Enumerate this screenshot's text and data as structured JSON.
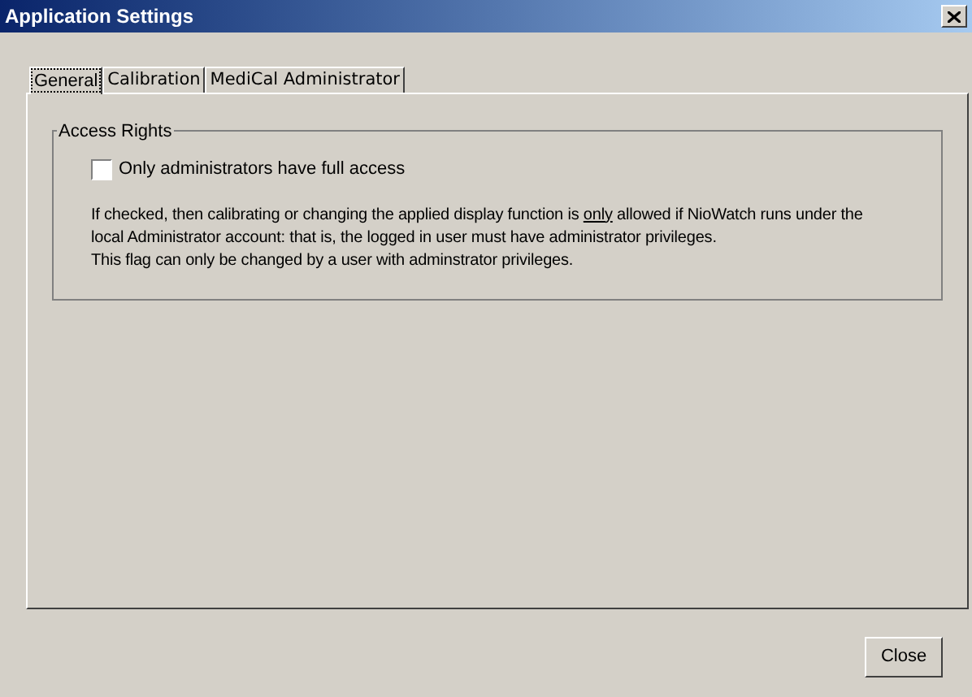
{
  "window": {
    "title": "Application Settings"
  },
  "tabs": [
    {
      "label": "General",
      "selected": true
    },
    {
      "label": "Calibration",
      "selected": false
    },
    {
      "label": "MediCal Administrator",
      "selected": false
    }
  ],
  "group": {
    "title": "Access Rights",
    "checkbox": {
      "label": "Only administrators have full access",
      "checked": false
    },
    "description": [
      [
        {
          "text": "If checked, then calibrating or changing the applied display function is ",
          "underline": false
        },
        {
          "text": "only",
          "underline": true
        },
        {
          "text": " allowed if NioWatch runs under the local Administrator account: that is, the logged in user must have administrator privileges.",
          "underline": false
        }
      ],
      [
        {
          "text": "This flag can only be changed by a user with adminstrator privileges.",
          "underline": false
        }
      ]
    ]
  },
  "buttons": [
    {
      "label": "Close"
    }
  ]
}
